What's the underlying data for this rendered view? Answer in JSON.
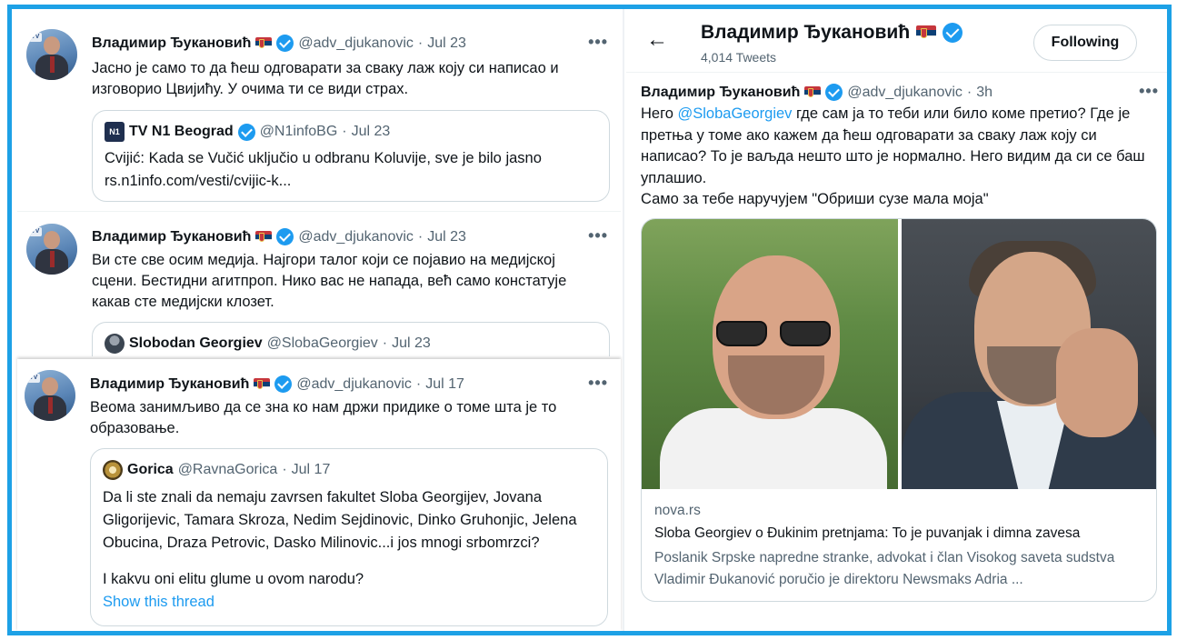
{
  "colors": {
    "accent": "#1d9bf0",
    "frame": "#1da1e6",
    "text": "#0f1419",
    "muted": "#536471"
  },
  "user": {
    "name": "Владимир Ђукановић",
    "handle": "@adv_djukanovic",
    "flag_icon": "serbia-flag-icon",
    "verified_icon": "verified-badge-icon"
  },
  "tweets": [
    {
      "date": "Jul 23",
      "text": "Јасно је само то да ћеш одговарати за сваку лаж коју си написао и изговорио Цвијићу. У очима ти се види страх.",
      "quote": {
        "name": "TV N1 Beograd",
        "handle": "@N1infoBG",
        "date": "Jul 23",
        "avatar_text": "N1",
        "text": "Cvijić: Kada se Vučić uključio u odbranu Koluvije, sve je bilo jasno rs.n1info.com/vesti/cvijic-k..."
      }
    },
    {
      "date": "Jul 23",
      "text": "Ви сте све осим медија. Најгори талог који се појавио на медијској сцени. Бестидни агитпроп. Нико вас не напада, већ само констатује какав сте медијски клозет.",
      "quote": {
        "name": "Slobodan Georgiev",
        "handle": "@SlobaGeorgiev",
        "date": "Jul 23"
      }
    },
    {
      "date": "Jul 17",
      "text": "Веома занимљиво да се зна ко нам држи придике о томе шта је то образовање.",
      "quote": {
        "name": "Gorica",
        "handle": "@RavnaGorica",
        "date": "Jul 17",
        "text": "Da li ste znali da nemaju zavrsen fakultet Sloba Georgijev, Jovana Gligorijevic, Tamara Skroza, Nedim Sejdinovic, Dinko Gruhonjic, Jelena Obucina, Draza Petrovic, Dasko Milinovic...i jos mnogi srbomrzci?",
        "text2": "I kakvu oni elitu glume u ovom narodu?",
        "thread_link": "Show this thread"
      }
    }
  ],
  "dot": "·",
  "more": "•••",
  "profile": {
    "back_icon": "←",
    "title": "Владимир Ђукановић",
    "tweet_count": "4,014 Tweets",
    "follow_label": "Following"
  },
  "main_tweet": {
    "time": "3h",
    "text_before": "Него ",
    "mention": "@SlobaGeorgiev",
    "text_after": " где сам ја то теби или било коме претио? Где је претња у томе ако кажем да ћеш одговарати за сваку лаж коју си написао? То је ваљда нешто што је нормално. Него видим да си се баш уплашио.",
    "text_line2": "Само за тебе наручујем \"Обриши сузе мала моја\"",
    "card": {
      "domain": "nova.rs",
      "title": "Sloba Georgiev o Đukinim pretnjama: To je puvanjak i dimna zavesa",
      "description": "Poslanik Srpske napredne stranke, advokat i član Visokog saveta sudstva Vladimir Đukanović poručio je direktoru Newsmaks Adria ..."
    }
  }
}
